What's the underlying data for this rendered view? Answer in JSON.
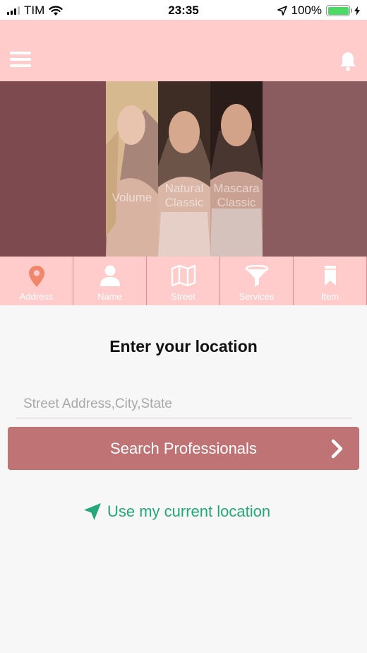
{
  "status_bar": {
    "carrier": "TIM",
    "time": "23:35",
    "battery": "100%"
  },
  "banner": {
    "panels": [
      {
        "label_line1": "",
        "label_line2": "Volume"
      },
      {
        "label_line1": "Natural",
        "label_line2": "Classic"
      },
      {
        "label_line1": "Mascara",
        "label_line2": "Classic"
      }
    ]
  },
  "tabs": [
    {
      "label": "Address",
      "icon": "location-pin-icon"
    },
    {
      "label": "Name",
      "icon": "person-icon"
    },
    {
      "label": "Street",
      "icon": "map-icon"
    },
    {
      "label": "Services",
      "icon": "filter-icon"
    },
    {
      "label": "Item",
      "icon": "bookmark-icon"
    }
  ],
  "main": {
    "title": "Enter your location",
    "address_placeholder": "Street Address,City,State",
    "search_button": "Search Professionals",
    "current_location": "Use my current location"
  },
  "colors": {
    "header_bg": "#ffcccb",
    "button_bg": "#bf7374",
    "link": "#22a879",
    "pin": "#f0866a"
  }
}
